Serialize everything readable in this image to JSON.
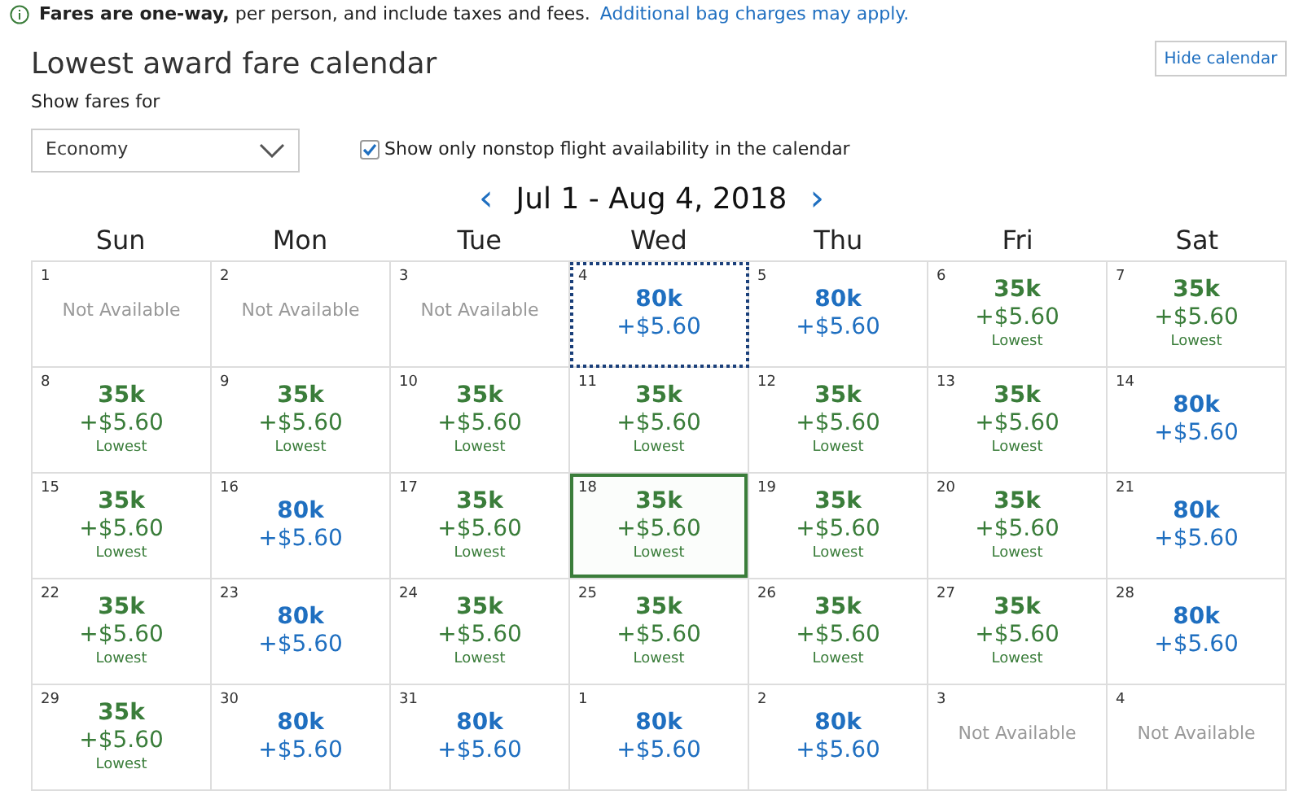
{
  "notice": {
    "text": "**Fares are one-way,** per person, and include taxes and fees.",
    "link": "Additional bag charges may apply."
  },
  "title": "Lowest award fare calendar",
  "hide_button": "Hide calendar",
  "fare_filter": {
    "label": "Show fares for",
    "value": "Economy"
  },
  "nonstop": {
    "label": "Show only nonstop flight availability in the calendar",
    "checked": true
  },
  "range": {
    "prev": "‹",
    "label": "Jul 1 - Aug 4, 2018",
    "next": "›"
  },
  "weekdays": [
    "Sun",
    "Mon",
    "Tue",
    "Wed",
    "Thu",
    "Fri",
    "Sat"
  ],
  "days": [
    {
      "day": "1",
      "kind": "unavailable",
      "text": "Not Available",
      "selected": false,
      "focused": false
    },
    {
      "day": "2",
      "kind": "unavailable",
      "text": "Not Available",
      "selected": false,
      "focused": false
    },
    {
      "day": "3",
      "kind": "unavailable",
      "text": "Not Available",
      "selected": false,
      "focused": false
    },
    {
      "day": "4",
      "kind": "fare",
      "miles": "80k",
      "tax": "+$5.60",
      "selected": false,
      "focused": true
    },
    {
      "day": "5",
      "kind": "fare",
      "miles": "80k",
      "tax": "+$5.60",
      "selected": false,
      "focused": false
    },
    {
      "day": "6",
      "kind": "lowest",
      "miles": "35k",
      "tax": "+$5.60",
      "note": "Lowest",
      "selected": false,
      "focused": false
    },
    {
      "day": "7",
      "kind": "lowest",
      "miles": "35k",
      "tax": "+$5.60",
      "note": "Lowest",
      "selected": false,
      "focused": false
    },
    {
      "day": "8",
      "kind": "lowest",
      "miles": "35k",
      "tax": "+$5.60",
      "note": "Lowest",
      "selected": false,
      "focused": false
    },
    {
      "day": "9",
      "kind": "lowest",
      "miles": "35k",
      "tax": "+$5.60",
      "note": "Lowest",
      "selected": false,
      "focused": false
    },
    {
      "day": "10",
      "kind": "lowest",
      "miles": "35k",
      "tax": "+$5.60",
      "note": "Lowest",
      "selected": false,
      "focused": false
    },
    {
      "day": "11",
      "kind": "lowest",
      "miles": "35k",
      "tax": "+$5.60",
      "note": "Lowest",
      "selected": false,
      "focused": false
    },
    {
      "day": "12",
      "kind": "lowest",
      "miles": "35k",
      "tax": "+$5.60",
      "note": "Lowest",
      "selected": false,
      "focused": false
    },
    {
      "day": "13",
      "kind": "lowest",
      "miles": "35k",
      "tax": "+$5.60",
      "note": "Lowest",
      "selected": false,
      "focused": false
    },
    {
      "day": "14",
      "kind": "fare",
      "miles": "80k",
      "tax": "+$5.60",
      "selected": false,
      "focused": false
    },
    {
      "day": "15",
      "kind": "lowest",
      "miles": "35k",
      "tax": "+$5.60",
      "note": "Lowest",
      "selected": false,
      "focused": false
    },
    {
      "day": "16",
      "kind": "fare",
      "miles": "80k",
      "tax": "+$5.60",
      "selected": false,
      "focused": false
    },
    {
      "day": "17",
      "kind": "lowest",
      "miles": "35k",
      "tax": "+$5.60",
      "note": "Lowest",
      "selected": false,
      "focused": false
    },
    {
      "day": "18",
      "kind": "lowest",
      "miles": "35k",
      "tax": "+$5.60",
      "note": "Lowest",
      "selected": true,
      "focused": false
    },
    {
      "day": "19",
      "kind": "lowest",
      "miles": "35k",
      "tax": "+$5.60",
      "note": "Lowest",
      "selected": false,
      "focused": false
    },
    {
      "day": "20",
      "kind": "lowest",
      "miles": "35k",
      "tax": "+$5.60",
      "note": "Lowest",
      "selected": false,
      "focused": false
    },
    {
      "day": "21",
      "kind": "fare",
      "miles": "80k",
      "tax": "+$5.60",
      "selected": false,
      "focused": false
    },
    {
      "day": "22",
      "kind": "lowest",
      "miles": "35k",
      "tax": "+$5.60",
      "note": "Lowest",
      "selected": false,
      "focused": false
    },
    {
      "day": "23",
      "kind": "fare",
      "miles": "80k",
      "tax": "+$5.60",
      "selected": false,
      "focused": false
    },
    {
      "day": "24",
      "kind": "lowest",
      "miles": "35k",
      "tax": "+$5.60",
      "note": "Lowest",
      "selected": false,
      "focused": false
    },
    {
      "day": "25",
      "kind": "lowest",
      "miles": "35k",
      "tax": "+$5.60",
      "note": "Lowest",
      "selected": false,
      "focused": false
    },
    {
      "day": "26",
      "kind": "lowest",
      "miles": "35k",
      "tax": "+$5.60",
      "note": "Lowest",
      "selected": false,
      "focused": false
    },
    {
      "day": "27",
      "kind": "lowest",
      "miles": "35k",
      "tax": "+$5.60",
      "note": "Lowest",
      "selected": false,
      "focused": false
    },
    {
      "day": "28",
      "kind": "fare",
      "miles": "80k",
      "tax": "+$5.60",
      "selected": false,
      "focused": false
    },
    {
      "day": "29",
      "kind": "lowest",
      "miles": "35k",
      "tax": "+$5.60",
      "note": "Lowest",
      "selected": false,
      "focused": false
    },
    {
      "day": "30",
      "kind": "fare",
      "miles": "80k",
      "tax": "+$5.60",
      "selected": false,
      "focused": false
    },
    {
      "day": "31",
      "kind": "fare",
      "miles": "80k",
      "tax": "+$5.60",
      "selected": false,
      "focused": false
    },
    {
      "day": "1",
      "kind": "fare",
      "miles": "80k",
      "tax": "+$5.60",
      "selected": false,
      "focused": false
    },
    {
      "day": "2",
      "kind": "fare",
      "miles": "80k",
      "tax": "+$5.60",
      "selected": false,
      "focused": false
    },
    {
      "day": "3",
      "kind": "unavailable",
      "text": "Not Available",
      "selected": false,
      "focused": false
    },
    {
      "day": "4",
      "kind": "unavailable",
      "text": "Not Available",
      "selected": false,
      "focused": false
    }
  ]
}
